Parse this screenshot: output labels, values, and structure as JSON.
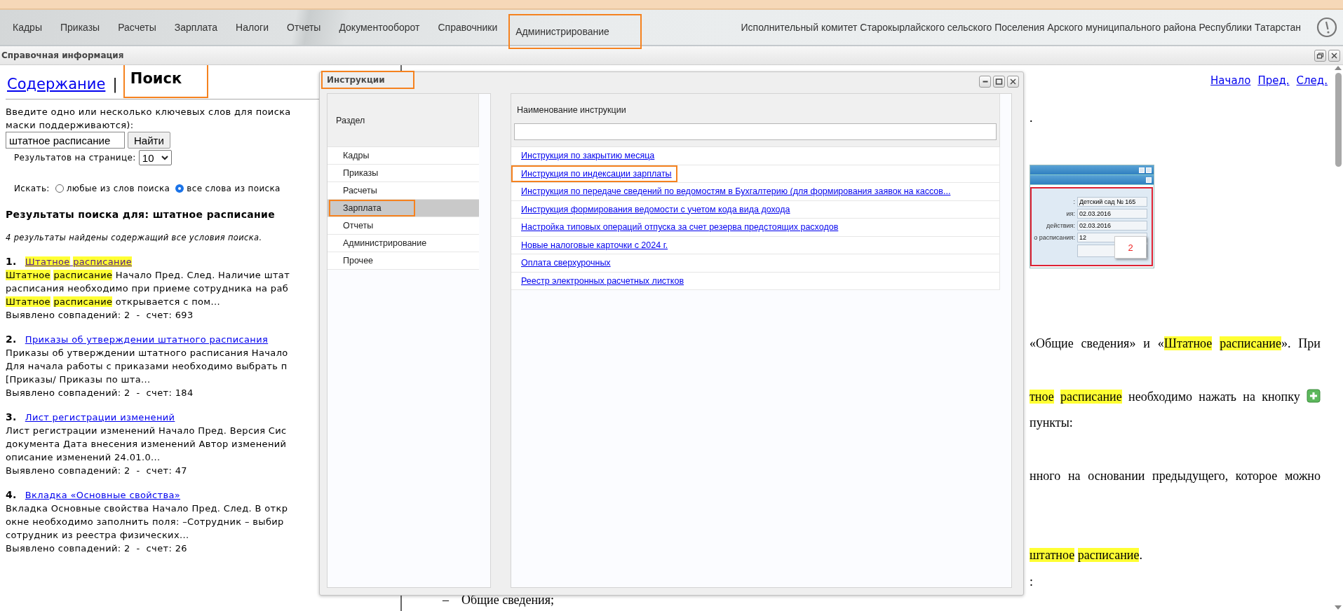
{
  "nav": {
    "items": [
      {
        "label": "Кадры",
        "marked": false
      },
      {
        "label": "Приказы",
        "marked": false
      },
      {
        "label": "Расчеты",
        "marked": false
      },
      {
        "label": "Зарплата",
        "marked": false
      },
      {
        "label": "Налоги",
        "marked": false
      },
      {
        "label": "Отчеты",
        "marked": false
      },
      {
        "label": "Документооборот",
        "marked": false
      },
      {
        "label": "Справочники",
        "marked": false
      },
      {
        "label": "Администрирование",
        "marked": true
      }
    ],
    "organization": "Исполнительный комитет Старокырлайского сельского Поселения Арского муниципального района Республики Татарстан"
  },
  "help_panel": {
    "title": "Справочная информация"
  },
  "search_panel": {
    "tabs": [
      {
        "label": "Содержание",
        "selected": false,
        "marked": false
      },
      {
        "label": "Поиск",
        "selected": true,
        "marked": true
      }
    ],
    "separator": "|",
    "intro": [
      "Введите одно или несколько ключевых слов для поиска",
      "маски поддерживаются):"
    ],
    "query": {
      "value": "штатное расписание"
    },
    "find_button": "Найти",
    "per_page": {
      "label": "Результатов на странице:",
      "value": "10"
    },
    "search_mode": {
      "label": "Искать:",
      "options": [
        {
          "label": "любые из слов поиска",
          "selected": false
        },
        {
          "label": "все слова из поиска",
          "selected": true
        }
      ]
    },
    "results_heading": "Результаты поиска для: штатное расписание",
    "results_summary": "4 результаты найдены содержащий все условия поиска.",
    "results": [
      {
        "number": "1.",
        "visited": true,
        "title": [
          {
            "text": "Штатное",
            "highlight": true
          },
          {
            "text": "расписание",
            "highlight": true
          }
        ],
        "snippet": [
          [
            {
              "text": "Штатное",
              "highlight": true
            },
            {
              "text": "расписание",
              "highlight": true
            },
            {
              "text": " Начало Пред. След. Наличие штат"
            }
          ],
          [
            {
              "text": "расписания необходимо при приеме сотрудника на раб"
            }
          ],
          [
            {
              "text": "Штатное",
              "highlight": true
            },
            {
              "text": "расписание",
              "highlight": true
            },
            {
              "text": " открывается с пом..."
            }
          ]
        ],
        "stats": "Выявлено совпадений: 2  -  счет: 693"
      },
      {
        "number": "2.",
        "visited": false,
        "title": [
          {
            "text": "Приказы об утверждении штатного расписания"
          }
        ],
        "snippet": [
          [
            {
              "text": "Приказы об утверждении штатного расписания Начало"
            }
          ],
          [
            {
              "text": "Для начала работы с приказами необходимо выбрать п"
            }
          ],
          [
            {
              "text": "[Приказы/ Приказы по шта..."
            }
          ]
        ],
        "stats": "Выявлено совпадений: 2  -  счет: 184"
      },
      {
        "number": "3.",
        "visited": false,
        "title": [
          {
            "text": "Лист регистрации изменений"
          }
        ],
        "snippet": [
          [
            {
              "text": "Лист регистрации изменений Начало Пред. Версия Сис"
            }
          ],
          [
            {
              "text": "документа Дата внесения изменений Автор изменений"
            }
          ],
          [
            {
              "text": "описание изменений 24.01.0..."
            }
          ]
        ],
        "stats": "Выявлено совпадений: 2  -  счет: 47"
      },
      {
        "number": "4.",
        "visited": false,
        "title": [
          {
            "text": "Вкладка «Основные свойства»"
          }
        ],
        "snippet": [
          [
            {
              "text": "Вкладка Основные свойства Начало Пред. След. В откр"
            }
          ],
          [
            {
              "text": "окне необходимо заполнить поля: –Сотрудник – выбир"
            }
          ],
          [
            {
              "text": "сотрудник из реестра физических..."
            }
          ]
        ],
        "stats": "Выявлено совпадений: 2  -  счет: 26"
      }
    ]
  },
  "document": {
    "nav_links": [
      "Начало",
      "Пред.",
      "След."
    ],
    "lines": [
      {
        "kind": "text",
        "segments": [
          {
            "text": "."
          }
        ]
      },
      {
        "kind": "figure",
        "fields": [
          {
            "label": ":",
            "value": "Детский сад № 165"
          },
          {
            "label": "ия:",
            "value": "02.03.2016"
          },
          {
            "label": "действия:",
            "value": "02.03.2016"
          },
          {
            "label": "о расписания:",
            "value": "12"
          }
        ],
        "callout": "2"
      },
      {
        "kind": "text",
        "segments": [
          {
            "text": "«Общие сведения» и «"
          },
          {
            "text": "Штатное",
            "highlight": true
          },
          {
            "text": "расписание",
            "highlight": true
          },
          {
            "text": "». При"
          }
        ]
      },
      {
        "kind": "button_line",
        "segments": [
          {
            "text": "тное",
            "highlight": true
          },
          {
            "text": "расписание",
            "highlight": true
          },
          {
            "text": " необходимо нажать на кнопку"
          }
        ]
      },
      {
        "kind": "text",
        "segments": [
          {
            "text": "пункты:"
          }
        ]
      },
      {
        "kind": "text",
        "segments": [
          {
            "text": "нного на основании предыдущего, которое можно"
          }
        ]
      },
      {
        "kind": "text",
        "segments": [
          {
            "text": "штатное",
            "highlight": true
          },
          {
            "text": "расписание",
            "highlight": true
          },
          {
            "text": "."
          }
        ]
      },
      {
        "kind": "text",
        "segments": [
          {
            "text": ":"
          }
        ]
      },
      {
        "kind": "bullet",
        "marker": "–",
        "segments": [
          {
            "text": "Общие сведения;"
          }
        ]
      }
    ]
  },
  "dialog": {
    "title": "Инструкции",
    "title_marked": true,
    "sections": {
      "header": "Раздел",
      "items": [
        {
          "label": "Кадры",
          "selected": false,
          "marked": false
        },
        {
          "label": "Приказы",
          "selected": false,
          "marked": false
        },
        {
          "label": "Расчеты",
          "selected": false,
          "marked": false
        },
        {
          "label": "Зарплата",
          "selected": true,
          "marked": true
        },
        {
          "label": "Отчеты",
          "selected": false,
          "marked": false
        },
        {
          "label": "Администрирование",
          "selected": false,
          "marked": false
        },
        {
          "label": "Прочее",
          "selected": false,
          "marked": false
        }
      ]
    },
    "instructions": {
      "header": "Наименование инструкции",
      "rows": [
        {
          "label": "Инструкция по закрытию месяца",
          "marked": false
        },
        {
          "label": "Инструкция по индексации зарплаты",
          "marked": true
        },
        {
          "label": "Инструкция по передаче сведений по ведомостям в Бухгалтерию (для формирования заявок на кассов...",
          "marked": false
        },
        {
          "label": "Инструкция формирования ведомости с учетом кода вида дохода",
          "marked": false
        },
        {
          "label": "Настройка типовых операций отпуска за счет резерва предстоящих расходов",
          "marked": false
        },
        {
          "label": "Новые налоговые карточки с 2024 г.",
          "marked": false
        },
        {
          "label": "Оплата сверхурочных",
          "marked": false
        },
        {
          "label": "Реестр электронных расчетных листков",
          "marked": false
        }
      ]
    }
  }
}
